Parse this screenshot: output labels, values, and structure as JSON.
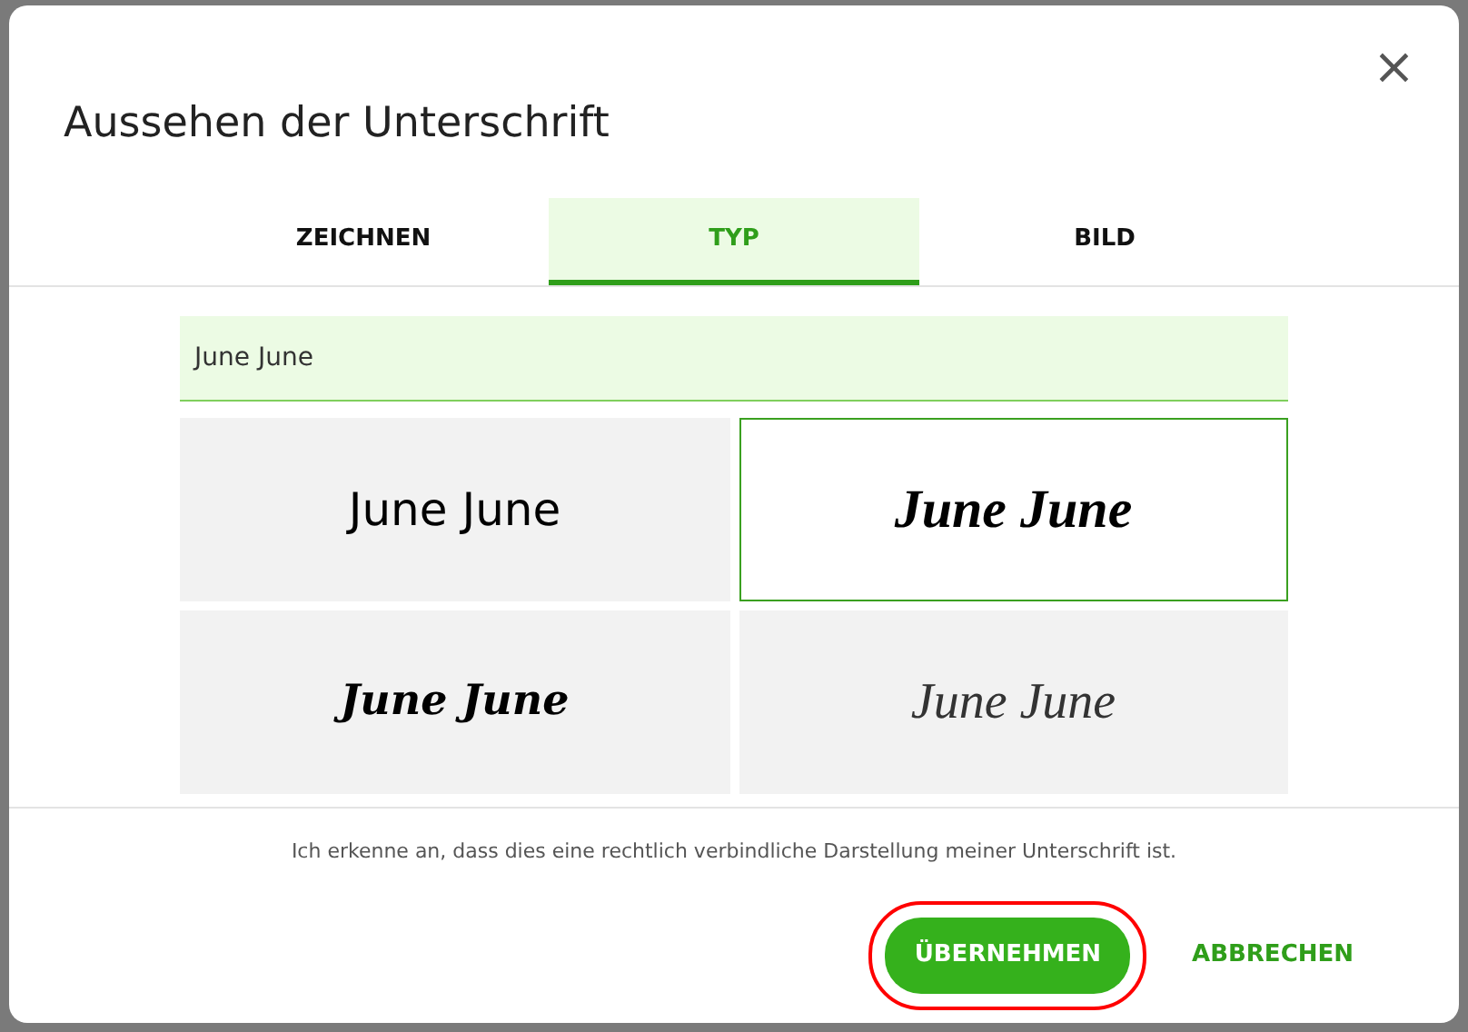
{
  "dialog": {
    "title": "Aussehen der Unterschrift",
    "close": "×"
  },
  "tabs": [
    {
      "label": "ZEICHNEN",
      "selected": false
    },
    {
      "label": "TYP",
      "selected": true
    },
    {
      "label": "BILD",
      "selected": false
    }
  ],
  "name_field": {
    "value": "June June"
  },
  "styles": [
    {
      "kind": "plain",
      "text": "June June",
      "selected": false
    },
    {
      "kind": "script",
      "text": "June June",
      "selected": true
    },
    {
      "kind": "bold-script",
      "text": "June June",
      "selected": false
    },
    {
      "kind": "thin-script",
      "text": "June June",
      "selected": false
    }
  ],
  "consent": "Ich erkenne an, dass dies eine rechtlich verbindliche Darstellung meiner Unterschrift ist.",
  "buttons": [
    {
      "kind": "primary",
      "label": "ÜBERNEHMEN",
      "highlighted": true
    },
    {
      "kind": "link",
      "label": "ABBRECHEN"
    }
  ]
}
